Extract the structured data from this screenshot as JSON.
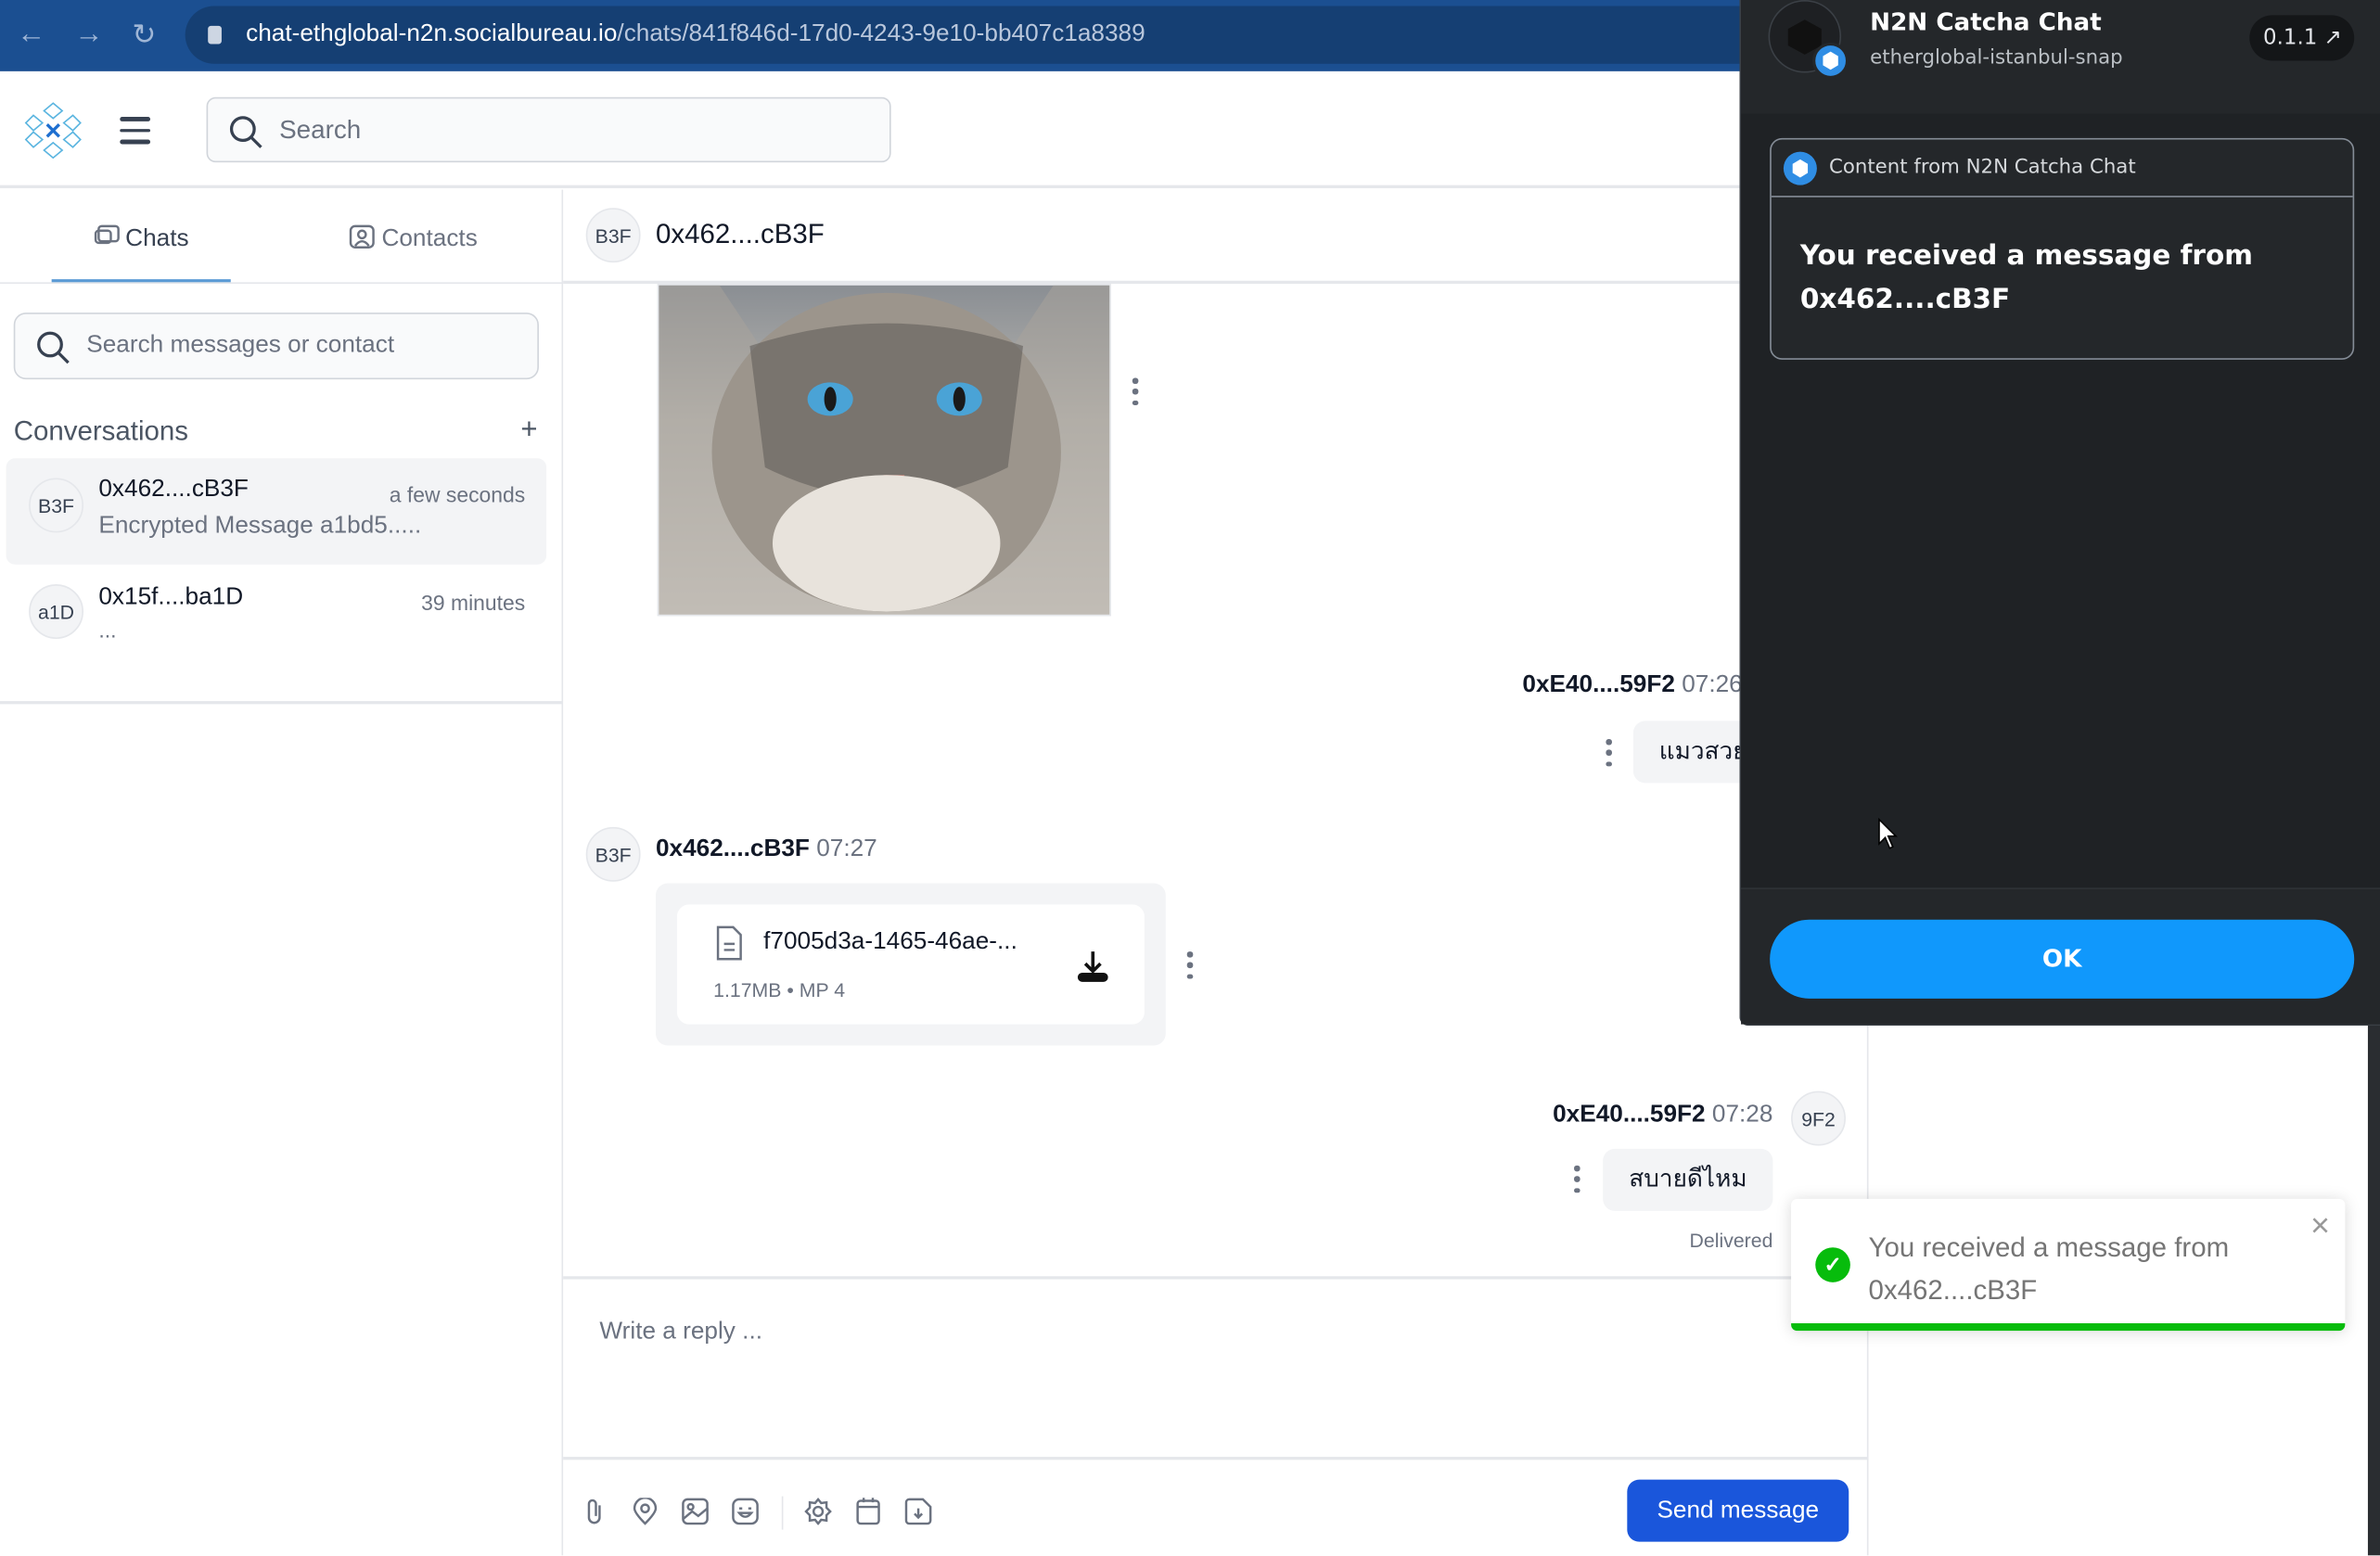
{
  "browser": {
    "url_host": "chat-ethglobal-n2n.socialbureau.io",
    "url_path": "/chats/841f846d-17d0-4243-9e10-bb407c1a8389"
  },
  "header": {
    "search_placeholder": "Search"
  },
  "sidebar": {
    "tabs": [
      {
        "label": "Chats",
        "active": true
      },
      {
        "label": "Contacts",
        "active": false
      }
    ],
    "search_placeholder": "Search messages or contact",
    "conversations_label": "Conversations",
    "add_label": "+",
    "conversations": [
      {
        "avatar": "B3F",
        "name": "0x462....cB3F",
        "time": "a few seconds",
        "preview": "Encrypted Message a1bd5.....",
        "selected": true
      },
      {
        "avatar": "a1D",
        "name": "0x15f....ba1D",
        "time": "39 minutes",
        "preview": "...",
        "selected": false
      }
    ]
  },
  "chat": {
    "header": {
      "avatar": "B3F",
      "name": "0x462....cB3F"
    },
    "messages": [
      {
        "sender": "0xE40....59F2",
        "time": "07",
        "text": "แมวสวย"
      },
      {
        "sender": "0x462....cB3F",
        "avatar": "B3F",
        "time": "07:27",
        "file": {
          "name": "f7005d3a-1465-46ae-...",
          "size": "1.17MB",
          "type": "MP 4"
        }
      },
      {
        "sender": "0xE40....59F2",
        "avatar": "9F2",
        "time": "07:28",
        "text": "สบายดีไหม",
        "status": "Delivered"
      }
    ],
    "reply_placeholder": "Write a reply ...",
    "send_label": "Send message",
    "file_meta_sep": " • "
  },
  "snap_popup": {
    "title": "N2N Catcha Chat",
    "subtitle": "etherglobal-istanbul-snap",
    "version": "0.1.1",
    "content_header": "Content from N2N Catcha Chat",
    "content_line1": "You received a message from",
    "content_line2": "0x462....cB3F",
    "ok_label": "OK"
  },
  "toast": {
    "line1": "You received a message from",
    "line2": "0x462....cB3F",
    "type": "success",
    "close": "×"
  },
  "colors": {
    "primary": "#1a56db",
    "snap_ok": "#1098fc",
    "success": "#07bc0c",
    "browser": "#1b4f91"
  }
}
